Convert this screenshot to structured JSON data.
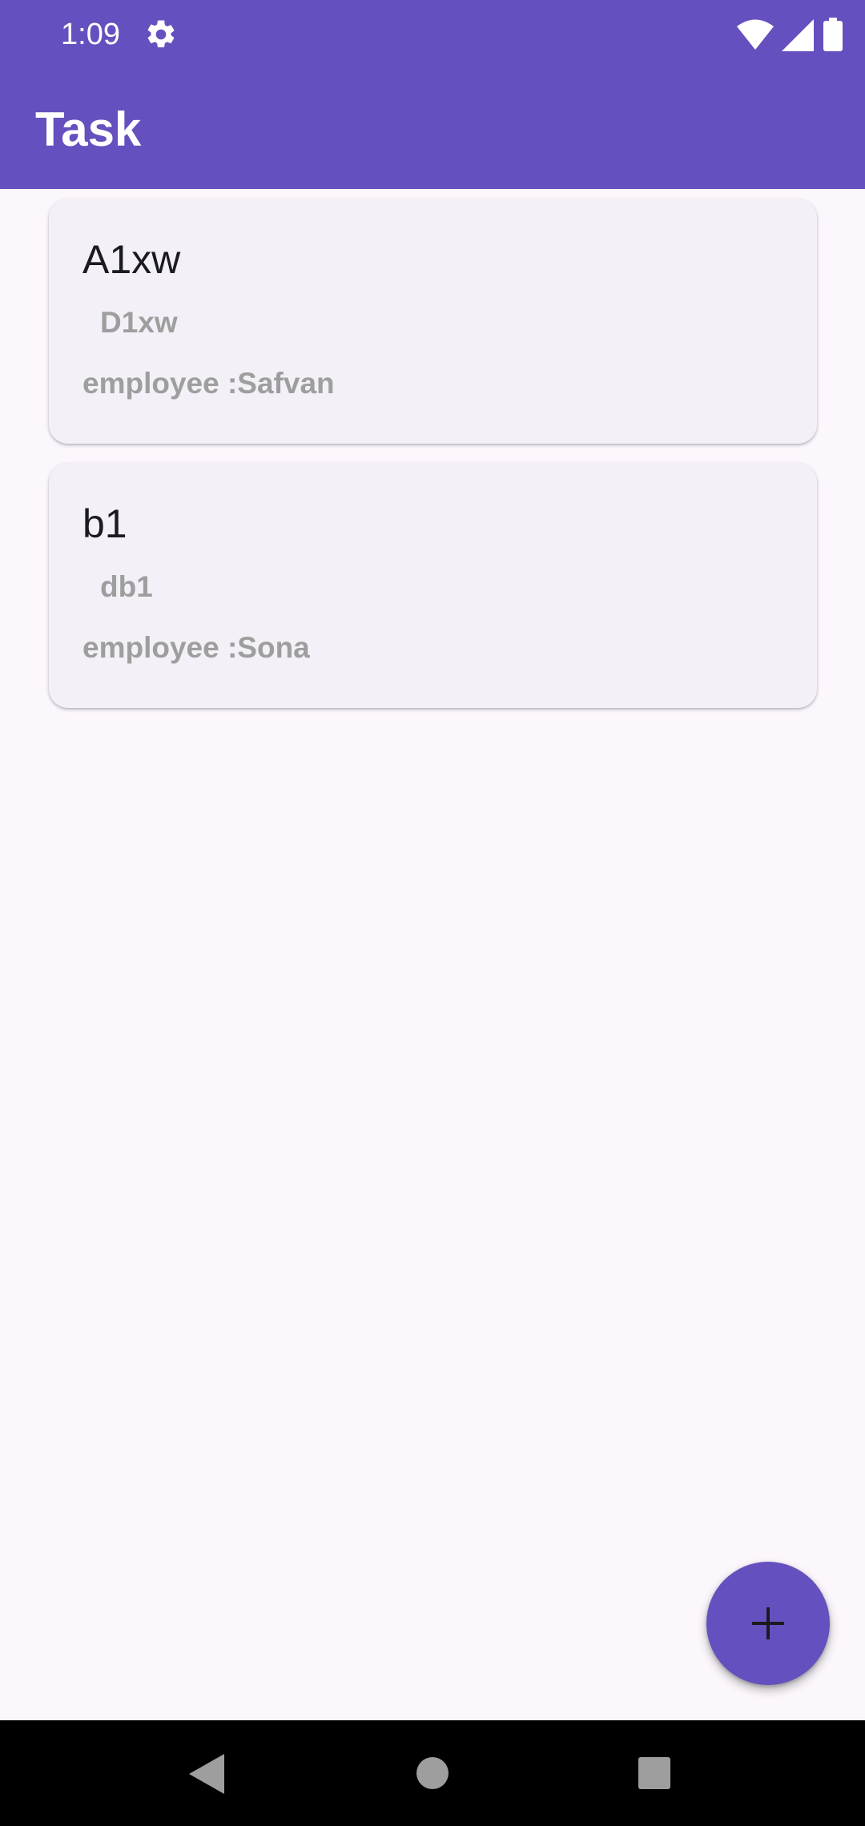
{
  "status_bar": {
    "time": "1:09",
    "icons": [
      "gear-icon",
      "wifi-icon",
      "cell-signal-icon",
      "battery-icon"
    ]
  },
  "app_bar": {
    "title": "Task"
  },
  "tasks": [
    {
      "title": "A1xw",
      "description": "D1xw",
      "employee": "employee :Safvan"
    },
    {
      "title": "b1",
      "description": "db1",
      "employee": "employee :Sona"
    }
  ],
  "fab": {
    "icon": "plus-icon"
  },
  "nav_bar": {
    "icons": [
      "back-icon",
      "home-icon",
      "recents-icon"
    ]
  },
  "colors": {
    "primary": "#6650BF",
    "background": "#FCF7FD",
    "card": "#F4F0F7",
    "secondary_text": "#9E9E9E"
  }
}
